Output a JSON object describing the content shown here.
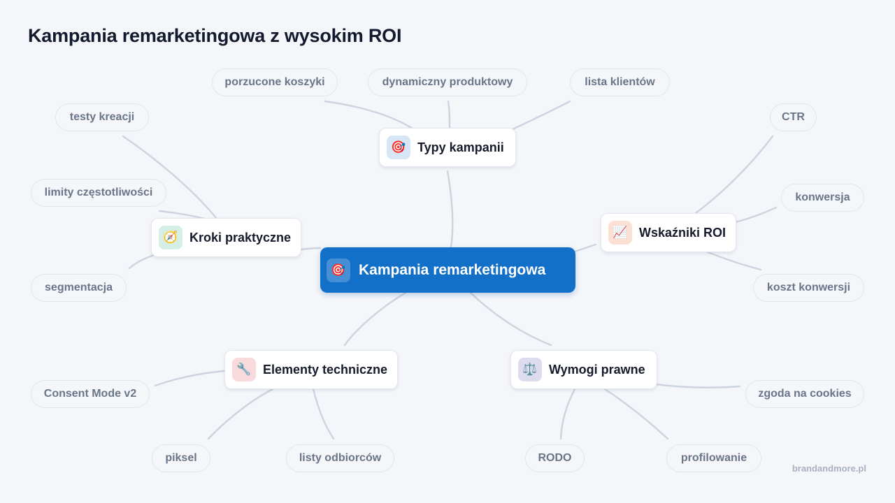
{
  "title": "Kampania remarketingowa z wysokim ROI",
  "central": {
    "label": "Kampania remarketingowa",
    "icon": "🎯",
    "color": "#1270c9"
  },
  "branches": {
    "types": {
      "label": "Typy kampanii",
      "icon": "🎯",
      "icon_bg": "#d6e6f7",
      "leaves": [
        "porzucone koszyki",
        "dynamiczny produktowy",
        "lista klientów"
      ]
    },
    "roi": {
      "label": "Wskaźniki ROI",
      "icon": "📈",
      "icon_bg": "#fde0d4",
      "leaves": [
        "CTR",
        "konwersja",
        "koszt konwersji"
      ]
    },
    "legal": {
      "label": "Wymogi prawne",
      "icon": "⚖️",
      "icon_bg": "#dcdcee",
      "leaves": [
        "zgoda na cookies",
        "profilowanie",
        "RODO"
      ]
    },
    "tech": {
      "label": "Elementy techniczne",
      "icon": "🔧",
      "icon_bg": "#f8d9dc",
      "leaves": [
        "listy odbiorców",
        "piksel",
        "Consent Mode v2"
      ]
    },
    "steps": {
      "label": "Kroki praktyczne",
      "icon": "🧭",
      "icon_bg": "#d6efe6",
      "leaves": [
        "segmentacja",
        "limity częstotliwości",
        "testy kreacji"
      ]
    }
  },
  "footer": "brandandmore.pl",
  "colors": {
    "background": "#f4f6fa",
    "connector": "#cdd3df",
    "leaf_text": "#6b7588"
  }
}
